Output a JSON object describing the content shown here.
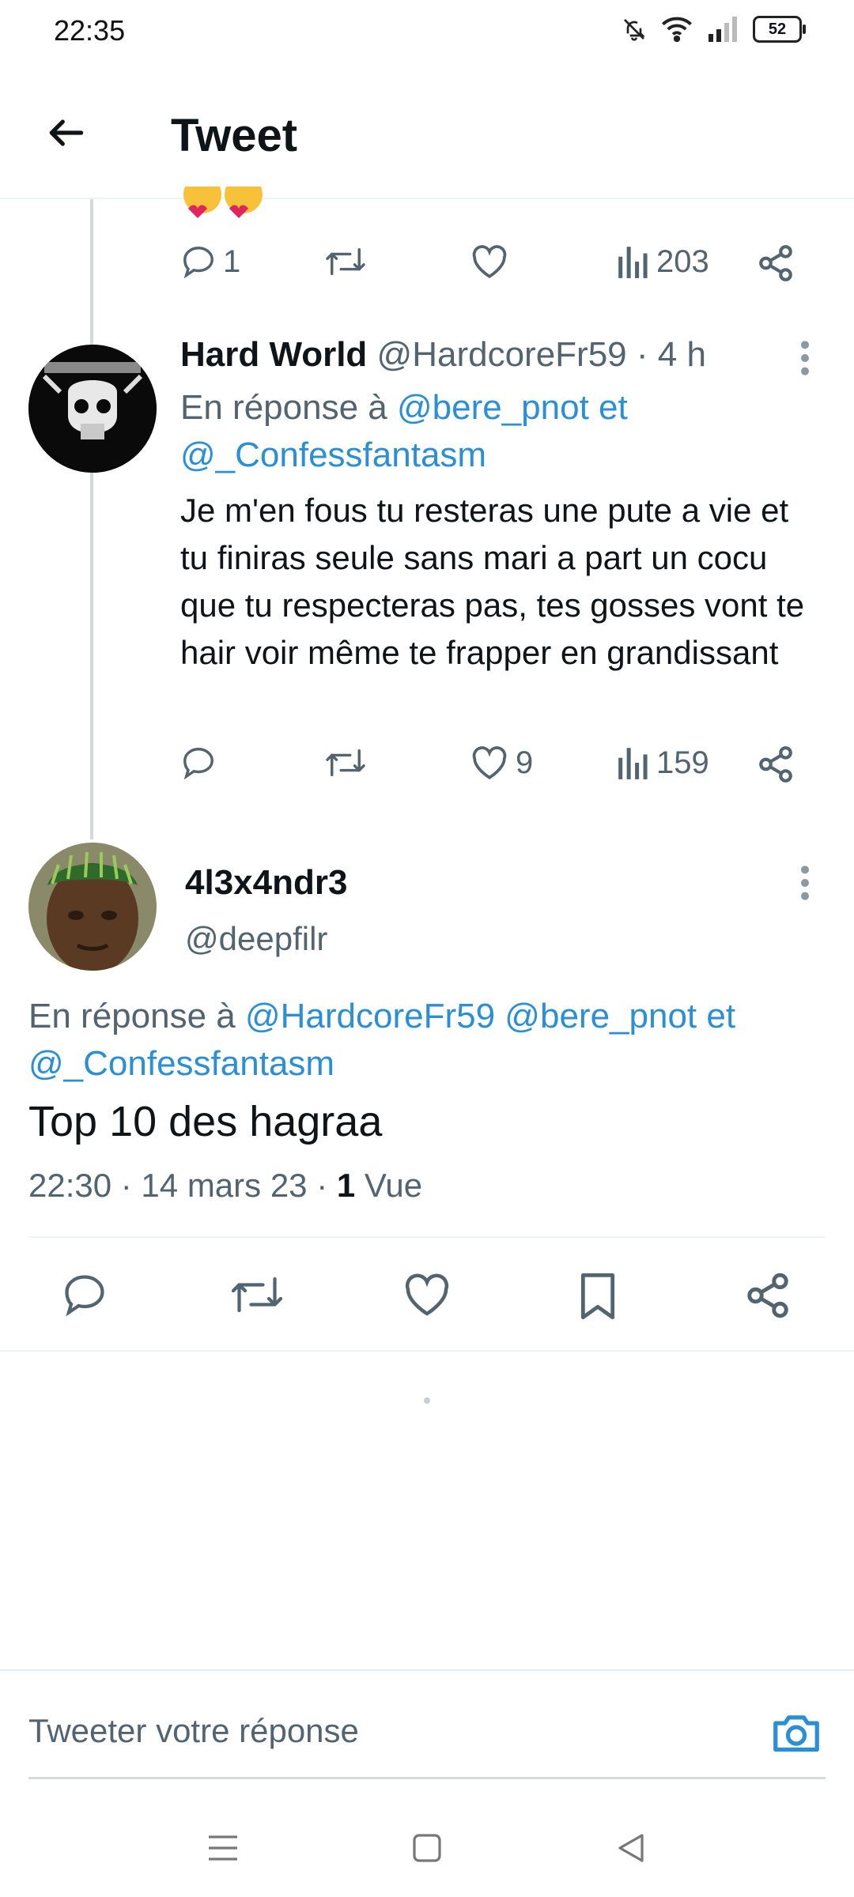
{
  "status_bar": {
    "time": "22:35",
    "battery": "52"
  },
  "header": {
    "title": "Tweet"
  },
  "parent_tweet_stats": {
    "replies": "1",
    "views": "203"
  },
  "reply_tweet": {
    "display_name": "Hard World",
    "handle": "@HardcoreFr59",
    "time": "· 4 h",
    "replying_prefix": "En réponse à",
    "replying_to": "@bere_pnot et",
    "replying_to_2": "@_Confessfantasm",
    "text": "Je m'en fous tu resteras une pute a vie et tu finiras seule sans mari a part un cocu que tu respecteras pas, tes gosses vont te hair voir même te frapper en grandissant",
    "likes": "9",
    "views": "159"
  },
  "main_tweet": {
    "display_name": "4l3x4ndr3",
    "handle": "@deepfilr",
    "replying_prefix": "En réponse à",
    "replying_to": "@HardcoreFr59 @bere_pnot et",
    "replying_to_2": "@_Confessfantasm",
    "text": "Top 10 des hagraa",
    "timestamp": "22:30 · 14 mars 23 ·",
    "view_count": "1",
    "view_label": "Vue"
  },
  "reply_bar": {
    "placeholder": "Tweeter votre réponse"
  },
  "colors": {
    "accent": "#2b8fd6",
    "muted": "#536471",
    "text": "#0f1419"
  }
}
